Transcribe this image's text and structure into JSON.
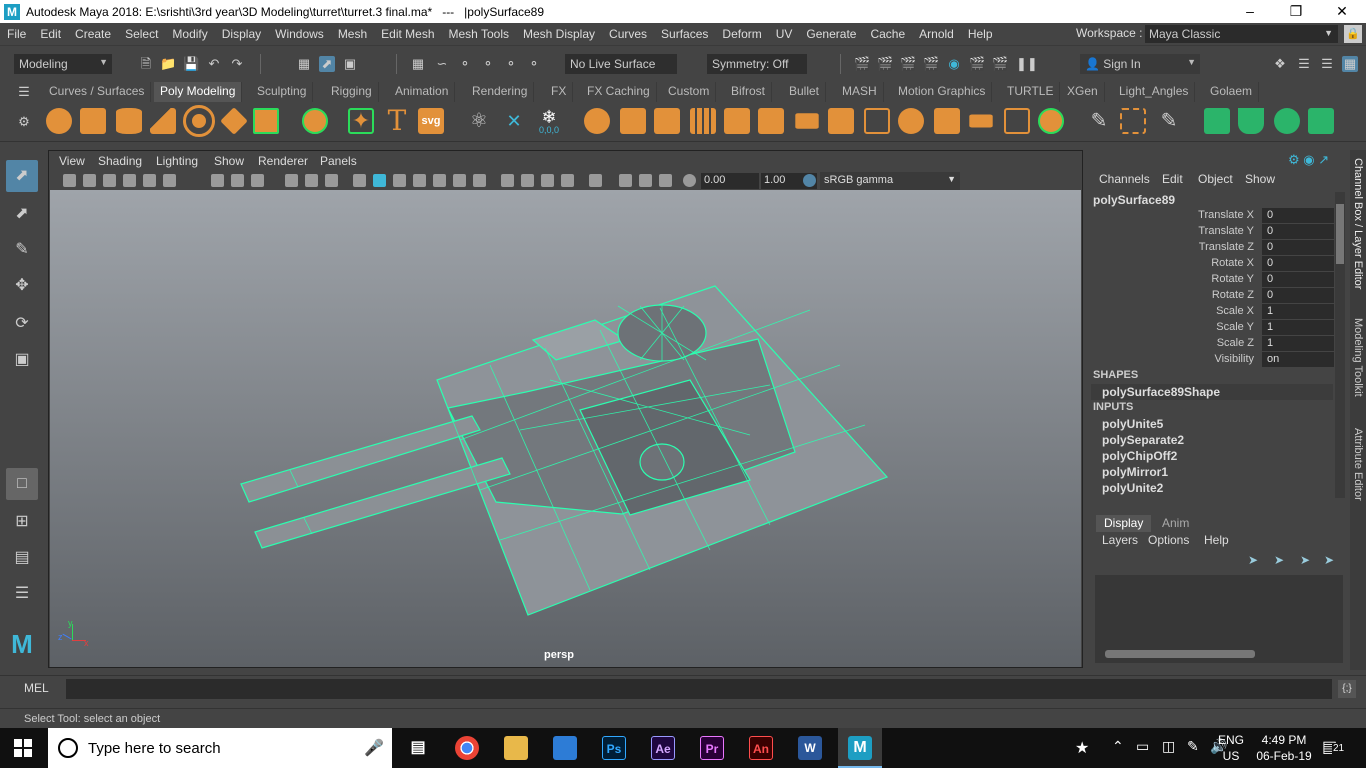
{
  "window": {
    "title": "Autodesk Maya 2018: E:\\srishti\\3rd year\\3D Modeling\\turret\\turret.3 final.ma*   ---   |polySurface89",
    "logo": "M",
    "controls": [
      "minimize-icon",
      "restore-icon",
      "close-icon"
    ]
  },
  "menubar": {
    "items": [
      "File",
      "Edit",
      "Create",
      "Select",
      "Modify",
      "Display",
      "Windows",
      "Mesh",
      "Edit Mesh",
      "Mesh Tools",
      "Mesh Display",
      "Curves",
      "Surfaces",
      "Deform",
      "UV",
      "Generate",
      "Cache",
      "Arnold",
      "Help"
    ],
    "workspace_label": "Workspace :",
    "workspace_value": "Maya Classic"
  },
  "statusline": {
    "menuset": "Modeling",
    "live_surface": "No Live Surface",
    "symmetry": "Symmetry: Off",
    "sign_in": "Sign In"
  },
  "shelf": {
    "tabs": [
      "Curves / Surfaces",
      "Poly Modeling",
      "Sculpting",
      "Rigging",
      "Animation",
      "Rendering",
      "FX",
      "FX Caching",
      "Custom",
      "Bifrost",
      "Bullet",
      "MASH",
      "Motion Graphics",
      "TURTLE",
      "XGen",
      "Light_Angles",
      "Golaem"
    ],
    "active_tab": "Poly Modeling",
    "text_icon_t": "T",
    "text_icon_svg": "svg",
    "coord_label": "0,0,0"
  },
  "viewport": {
    "menus": [
      "View",
      "Shading",
      "Lighting",
      "Show",
      "Renderer",
      "Panels"
    ],
    "exposure": "0.00",
    "gamma": "1.00",
    "color_space": "sRGB gamma",
    "camera_label": "persp",
    "axis_labels": [
      "y",
      "z",
      "x"
    ]
  },
  "channel_box": {
    "menus": [
      "Channels",
      "Edit",
      "Object",
      "Show"
    ],
    "object_name": "polySurface89",
    "attributes": [
      {
        "label": "Translate X",
        "value": "0"
      },
      {
        "label": "Translate Y",
        "value": "0"
      },
      {
        "label": "Translate Z",
        "value": "0"
      },
      {
        "label": "Rotate X",
        "value": "0"
      },
      {
        "label": "Rotate Y",
        "value": "0"
      },
      {
        "label": "Rotate Z",
        "value": "0"
      },
      {
        "label": "Scale X",
        "value": "1"
      },
      {
        "label": "Scale Y",
        "value": "1"
      },
      {
        "label": "Scale Z",
        "value": "1"
      },
      {
        "label": "Visibility",
        "value": "on"
      }
    ],
    "shapes_header": "SHAPES",
    "shape_node": "polySurface89Shape",
    "inputs_header": "INPUTS",
    "input_nodes": [
      "polyUnite5",
      "polySeparate2",
      "polyChipOff2",
      "polyMirror1",
      "polyUnite2"
    ]
  },
  "side_tabs": [
    "Channel Box / Layer Editor",
    "Modeling Toolkit",
    "Attribute Editor"
  ],
  "layer_editor": {
    "tabs": [
      "Display",
      "Anim"
    ],
    "active_tab": "Display",
    "menus": [
      "Layers",
      "Options",
      "Help"
    ]
  },
  "command_line": {
    "label": "MEL"
  },
  "help_line": {
    "text": "Select Tool: select an object"
  },
  "taskbar": {
    "search_placeholder": "Type here to search",
    "apps": [
      "Ps",
      "Ae",
      "Pr",
      "An",
      "W"
    ],
    "language": "ENG",
    "region": "US",
    "time": "4:49 PM",
    "date": "06-Feb-19",
    "notifications": "21"
  },
  "colors": {
    "wireframe": "#2bffb0",
    "accent": "#5285a6",
    "maya_blue": "#1d9ec3"
  }
}
